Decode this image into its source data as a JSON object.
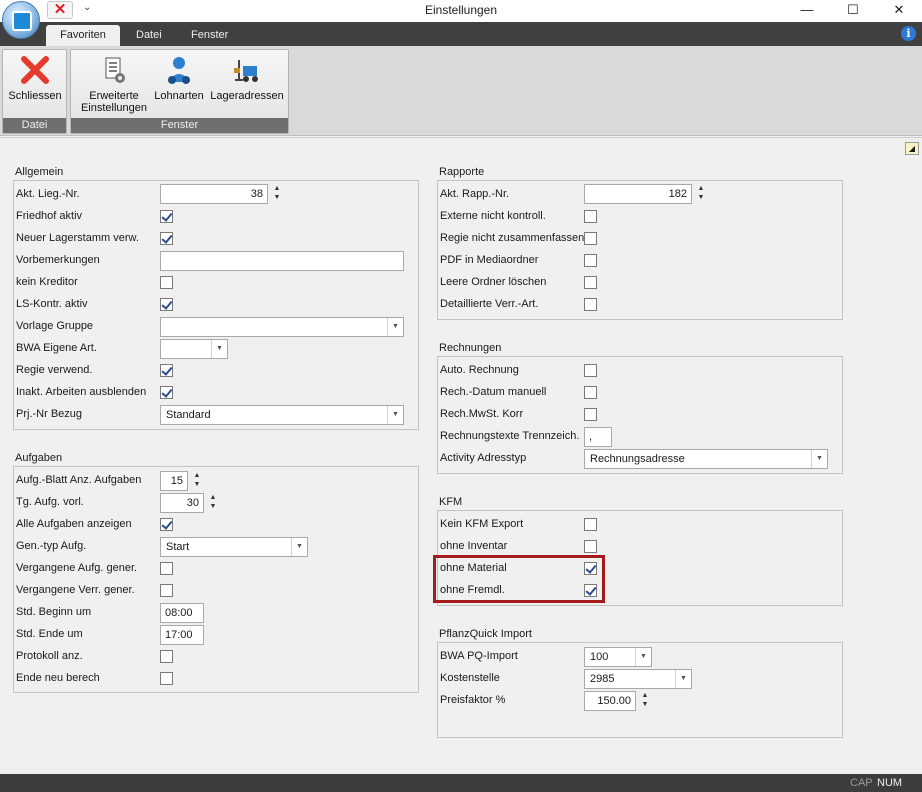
{
  "window": {
    "title": "Einstellungen",
    "minimize": "—",
    "maximize": "☐",
    "close": "✕"
  },
  "qat": {
    "close_glyph": "✕",
    "dropdown_glyph": "⌄"
  },
  "tabs": [
    {
      "label": "Favoriten",
      "active": true
    },
    {
      "label": "Datei",
      "active": false
    },
    {
      "label": "Fenster",
      "active": false
    }
  ],
  "info_glyph": "i",
  "ribbon": {
    "groups": [
      {
        "label": "Datei",
        "buttons": [
          {
            "label": "Schliessen",
            "icon": "close-x-icon"
          }
        ]
      },
      {
        "label": "Fenster",
        "buttons": [
          {
            "label_line1": "Erweiterte",
            "label_line2": "Einstellungen",
            "icon": "settings-document-icon"
          },
          {
            "label": "Lohnarten",
            "icon": "user-gear-icon"
          },
          {
            "label": "Lageradressen",
            "icon": "forklift-icon"
          }
        ]
      }
    ]
  },
  "corner_glyph": "◢",
  "allgemein": {
    "title": "Allgemein",
    "rows": [
      {
        "label": "Akt. Lieg.-Nr.",
        "type": "spin",
        "value": "38"
      },
      {
        "label": "Friedhof aktiv",
        "type": "checkbox",
        "checked": true
      },
      {
        "label": "Neuer Lagerstamm verw.",
        "type": "checkbox",
        "checked": true
      },
      {
        "label": "Vorbemerkungen",
        "type": "text",
        "value": ""
      },
      {
        "label": "kein Kreditor",
        "type": "checkbox",
        "checked": false
      },
      {
        "label": "LS-Kontr. aktiv",
        "type": "checkbox",
        "checked": true
      },
      {
        "label": "Vorlage Gruppe",
        "type": "combo",
        "value": ""
      },
      {
        "label": "BWA Eigene Art.",
        "type": "combo",
        "value": ""
      },
      {
        "label": "Regie verwend.",
        "type": "checkbox",
        "checked": true
      },
      {
        "label": "Inakt. Arbeiten ausblenden",
        "type": "checkbox",
        "checked": true
      },
      {
        "label": "Prj.-Nr Bezug",
        "type": "combo",
        "value": "Standard"
      }
    ]
  },
  "aufgaben": {
    "title": "Aufgaben",
    "rows": [
      {
        "label": "Aufg.-Blatt Anz. Aufgaben",
        "type": "spin",
        "value": "15"
      },
      {
        "label": "Tg. Aufg. vorl.",
        "type": "spin",
        "value": "30"
      },
      {
        "label": "Alle Aufgaben anzeigen",
        "type": "checkbox",
        "checked": true
      },
      {
        "label": "Gen.-typ Aufg.",
        "type": "combo",
        "value": "Start"
      },
      {
        "label": "Vergangene Aufg. gener.",
        "type": "checkbox",
        "checked": false
      },
      {
        "label": "Vergangene Verr. gener.",
        "type": "checkbox",
        "checked": false
      },
      {
        "label": "Std. Beginn um",
        "type": "text",
        "value": "08:00"
      },
      {
        "label": "Std. Ende um",
        "type": "text",
        "value": "17:00"
      },
      {
        "label": "Protokoll anz.",
        "type": "checkbox",
        "checked": false
      },
      {
        "label": "Ende neu berech",
        "type": "checkbox",
        "checked": false
      }
    ]
  },
  "rapporte": {
    "title": "Rapporte",
    "rows": [
      {
        "label": "Akt. Rapp.-Nr.",
        "type": "spin",
        "value": "182"
      },
      {
        "label": "Externe nicht kontroll.",
        "type": "checkbox",
        "checked": false
      },
      {
        "label": "Regie nicht zusammenfassen",
        "type": "checkbox",
        "checked": false
      },
      {
        "label": "PDF in Mediaordner",
        "type": "checkbox",
        "checked": false
      },
      {
        "label": "Leere Ordner löschen",
        "type": "checkbox",
        "checked": false
      },
      {
        "label": "Detaillierte Verr.-Art.",
        "type": "checkbox",
        "checked": false
      }
    ]
  },
  "rechnungen": {
    "title": "Rechnungen",
    "rows": [
      {
        "label": "Auto. Rechnung",
        "type": "checkbox",
        "checked": false
      },
      {
        "label": "Rech.-Datum manuell",
        "type": "checkbox",
        "checked": false
      },
      {
        "label": "Rech.MwSt. Korr",
        "type": "checkbox",
        "checked": false
      },
      {
        "label": "Rechnungstexte Trennzeich.",
        "type": "text",
        "value": ","
      },
      {
        "label": "Activity Adresstyp",
        "type": "combo",
        "value": "Rechnungsadresse"
      }
    ]
  },
  "kfm": {
    "title": "KFM",
    "rows": [
      {
        "label": "Kein KFM Export",
        "type": "checkbox",
        "checked": false
      },
      {
        "label": "ohne Inventar",
        "type": "checkbox",
        "checked": false
      },
      {
        "label": "ohne Material",
        "type": "checkbox",
        "checked": true
      },
      {
        "label": "ohne Fremdl.",
        "type": "checkbox",
        "checked": true
      }
    ]
  },
  "pflanzquick": {
    "title": "PflanzQuick Import",
    "rows": [
      {
        "label": "BWA PQ-Import",
        "type": "combo",
        "value": "100"
      },
      {
        "label": "Kostenstelle",
        "type": "combo",
        "value": "2985"
      },
      {
        "label": "Preisfaktor %",
        "type": "spin",
        "value": "150.00"
      }
    ]
  },
  "spin_glyphs": {
    "up": "▲",
    "down": "▼"
  },
  "combo_glyph": "▼",
  "statusbar": {
    "cap": "CAP",
    "num": "NUM"
  }
}
